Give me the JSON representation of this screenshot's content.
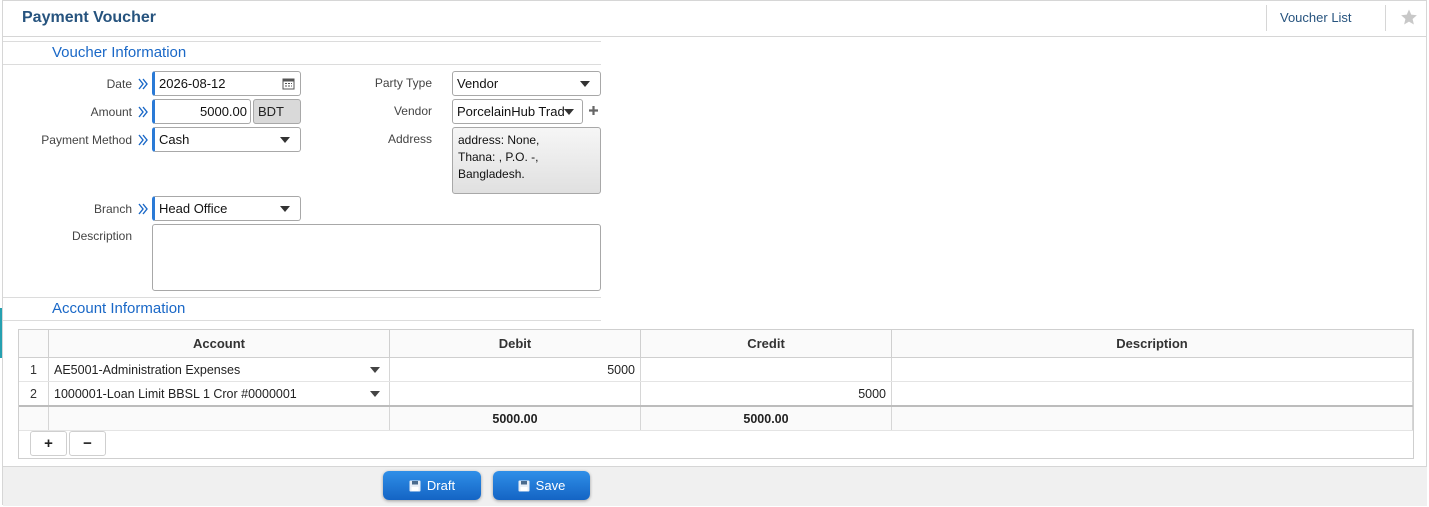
{
  "header": {
    "title": "Payment Voucher",
    "voucher_list_label": "Voucher List",
    "favorite_icon": "star-icon"
  },
  "voucher_info": {
    "section_title": "Voucher Information",
    "date": {
      "label": "Date",
      "value": "2026-08-12"
    },
    "amount": {
      "label": "Amount",
      "value": "5000.00",
      "currency": "BDT"
    },
    "payment_method": {
      "label": "Payment Method",
      "value": "Cash"
    },
    "branch": {
      "label": "Branch",
      "value": "Head Office"
    },
    "description": {
      "label": "Description",
      "value": ""
    },
    "party_type": {
      "label": "Party Type",
      "value": "Vendor"
    },
    "vendor": {
      "label": "Vendor",
      "value": "PorcelainHub Trad"
    },
    "address": {
      "label": "Address",
      "lines": [
        "address: None,",
        "Thana: , P.O. -,",
        "Bangladesh."
      ]
    }
  },
  "account_info": {
    "section_title": "Account Information",
    "columns": [
      "Account",
      "Debit",
      "Credit",
      "Description"
    ],
    "rows": [
      {
        "no": "1",
        "account": "AE5001-Administration Expenses",
        "debit": "5000",
        "credit": "",
        "description": ""
      },
      {
        "no": "2",
        "account": "1000001-Loan Limit BBSL 1 Cror #0000001",
        "debit": "",
        "credit": "5000",
        "description": ""
      }
    ],
    "totals": {
      "debit": "5000.00",
      "credit": "5000.00"
    },
    "add_row_label": "+",
    "remove_row_label": "−"
  },
  "actions": {
    "draft_label": "Draft",
    "save_label": "Save"
  },
  "colors": {
    "accent": "#1a68c7",
    "title": "#26537e",
    "button": "#1e78d6"
  }
}
